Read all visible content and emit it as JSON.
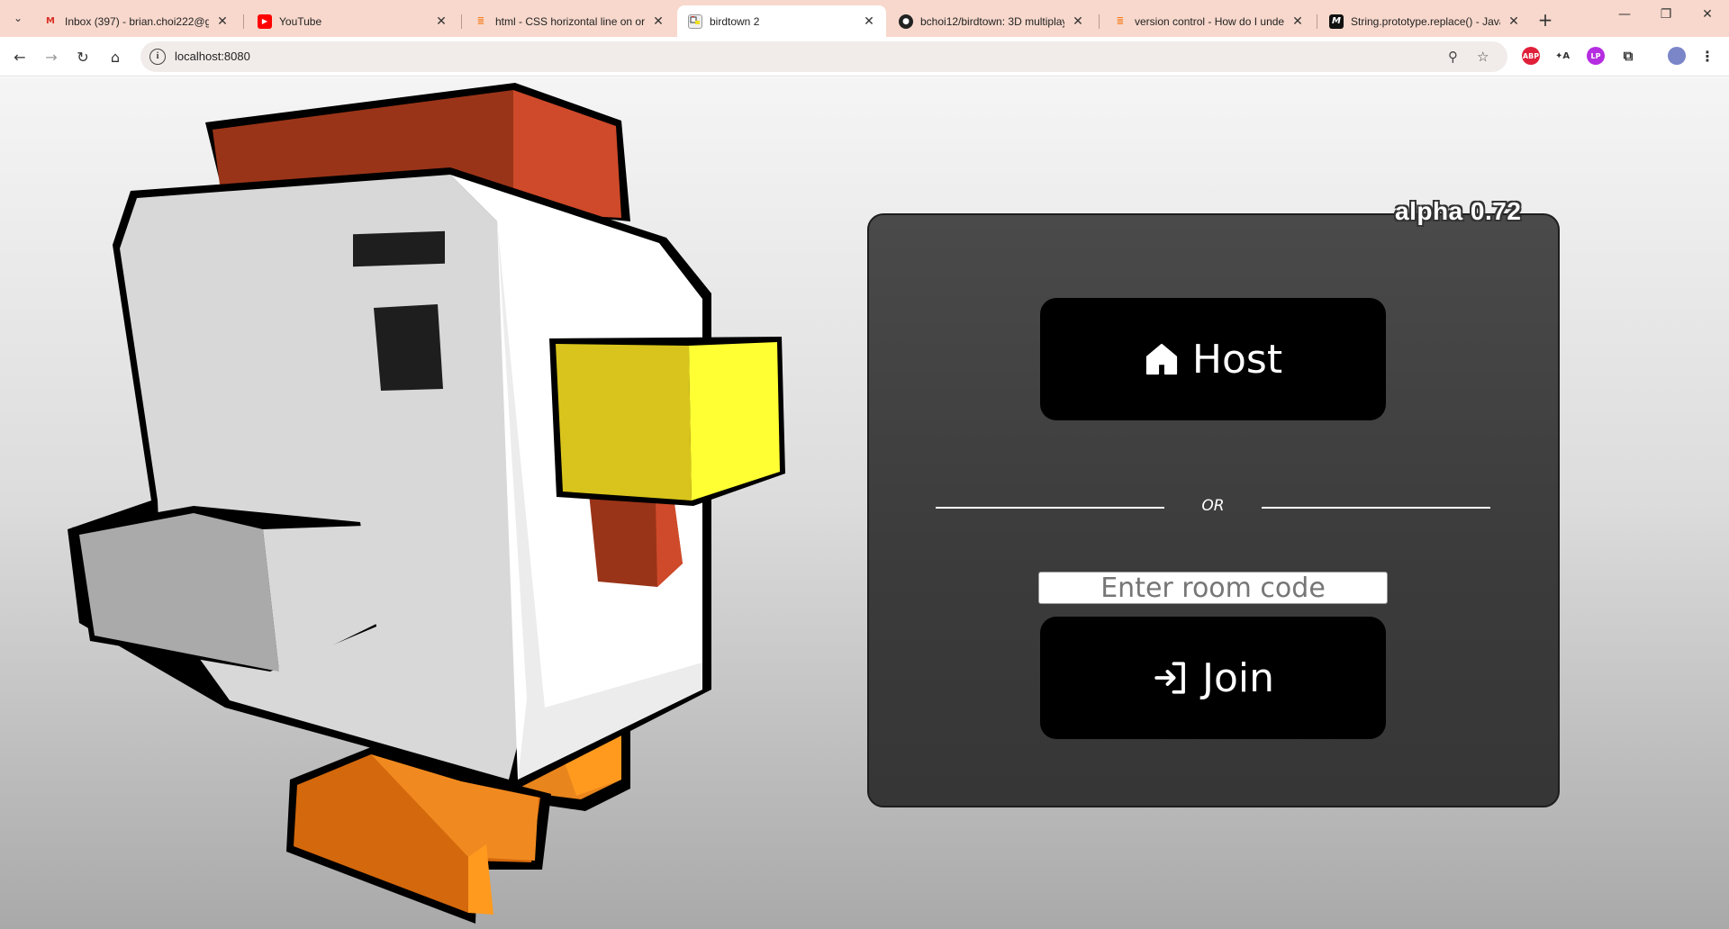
{
  "browser": {
    "tabs": [
      {
        "title": "Inbox (397) - brian.choi222@gm",
        "icon": "gmail-icon"
      },
      {
        "title": "YouTube",
        "icon": "youtube-icon"
      },
      {
        "title": "html - CSS horizontal line on or",
        "icon": "stackoverflow-icon"
      },
      {
        "title": "birdtown 2",
        "icon": "birdtown-icon"
      },
      {
        "title": "bchoi12/birdtown: 3D multiplay",
        "icon": "github-icon"
      },
      {
        "title": "version control - How do I unde",
        "icon": "stackoverflow-icon"
      },
      {
        "title": "String.prototype.replace() - Java",
        "icon": "mdn-icon"
      }
    ],
    "active_tab_index": 3,
    "url": "localhost:8080",
    "extensions": [
      "abp-icon",
      "translate-icon",
      "extension-purple-icon",
      "puzzle-icon",
      "profile-avatar"
    ]
  },
  "game": {
    "version": "alpha 0.72",
    "host_label": "Host",
    "or_label": "OR",
    "room_code_placeholder": "Enter room code",
    "room_code_value": "",
    "join_label": "Join"
  },
  "colors": {
    "tabbar_bg": "#f8d8cc",
    "panel_bg": "#404040",
    "button_bg": "#000000",
    "chicken_body": "#ffffff",
    "chicken_comb": "#cc4a2a",
    "chicken_beak": "#f7f52e",
    "chicken_feet": "#f08a20"
  }
}
